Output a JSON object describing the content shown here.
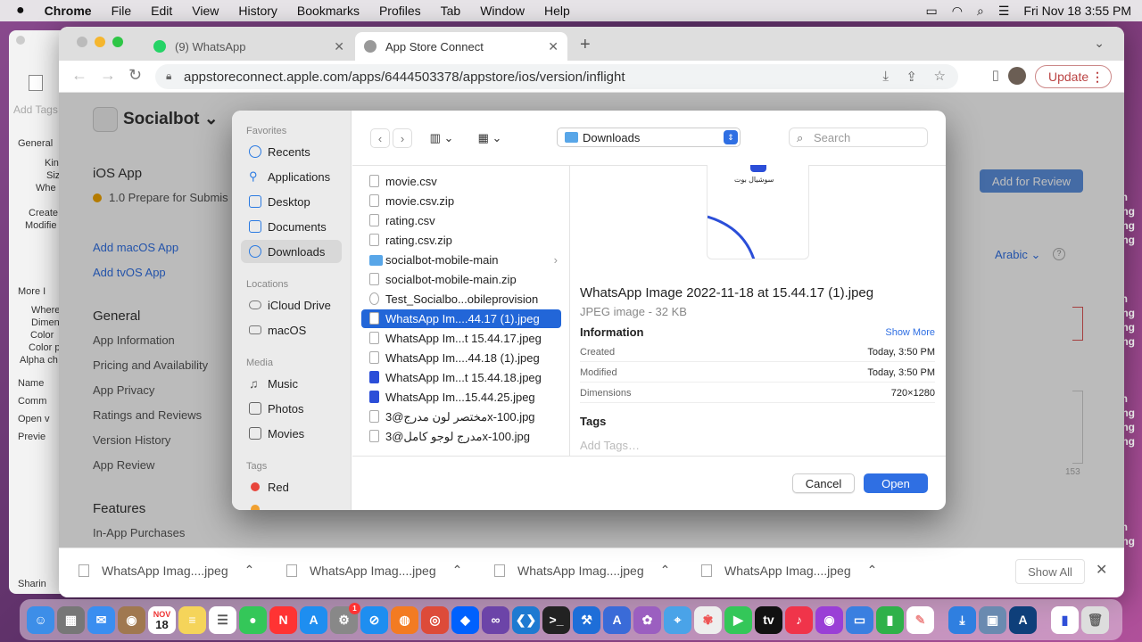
{
  "menubar": {
    "app": "Chrome",
    "items": [
      "File",
      "Edit",
      "View",
      "History",
      "Bookmarks",
      "Profiles",
      "Tab",
      "Window",
      "Help"
    ],
    "datetime": "Fri Nov 18  3:55 PM"
  },
  "behind_window": {
    "add_tags": "Add Tags",
    "labels": [
      "General",
      "Kin",
      "Siz",
      "Whe",
      "Create",
      "Modifie",
      "More I",
      "Where",
      "Dimen",
      "Color",
      "Color p",
      "Alpha ch",
      "Name",
      "Comm",
      "Open v",
      "Previe",
      "Sharin"
    ]
  },
  "right_strip": [
    "en",
    "ong",
    "ong",
    "ong",
    "en",
    "ong",
    "ong",
    "ong",
    "en",
    "ong",
    "ong",
    "ong",
    "en",
    "ong"
  ],
  "browser": {
    "tabs": [
      {
        "title": "(9) WhatsApp",
        "favicon_color": "#25d366"
      },
      {
        "title": "App Store Connect",
        "favicon_color": "#888888"
      }
    ],
    "url": "appstoreconnect.apple.com/apps/6444503378/appstore/ios/version/inflight",
    "update_label": "Update"
  },
  "page": {
    "app_name": "Socialbot",
    "ios_app": "iOS App",
    "version": "1.0 Prepare for Submis",
    "add_macos": "Add macOS App",
    "add_tvos": "Add tvOS App",
    "general_heading": "General",
    "general_items": [
      "App Information",
      "Pricing and Availability",
      "App Privacy",
      "Ratings and Reviews",
      "Version History",
      "App Review"
    ],
    "features_heading": "Features",
    "features_items": [
      "In-App Purchases"
    ],
    "add_for_review": "Add for Review",
    "language": "Arabic",
    "char_count": "153"
  },
  "downloads_bar": {
    "items": [
      "WhatsApp Imag....jpeg",
      "WhatsApp Imag....jpeg",
      "WhatsApp Imag....jpeg",
      "WhatsApp Imag....jpeg"
    ],
    "show_all": "Show All"
  },
  "dialog": {
    "sidebar": {
      "favorites_label": "Favorites",
      "favorites": [
        "Recents",
        "Applications",
        "Desktop",
        "Documents",
        "Downloads"
      ],
      "locations_label": "Locations",
      "locations": [
        "iCloud Drive",
        "macOS"
      ],
      "media_label": "Media",
      "media": [
        "Music",
        "Photos",
        "Movies"
      ],
      "tags_label": "Tags",
      "tags": [
        "Red"
      ]
    },
    "location": "Downloads",
    "search_placeholder": "Search",
    "files": [
      {
        "name": "movie.csv"
      },
      {
        "name": "movie.csv.zip"
      },
      {
        "name": "rating.csv"
      },
      {
        "name": "rating.csv.zip"
      },
      {
        "name": "socialbot-mobile-main",
        "chevron": "›"
      },
      {
        "name": "socialbot-mobile-main.zip"
      },
      {
        "name": "Test_Socialbo...obileprovision"
      },
      {
        "name": "WhatsApp Im....44.17 (1).jpeg"
      },
      {
        "name": "WhatsApp Im...t 15.44.17.jpeg"
      },
      {
        "name": "WhatsApp Im....44.18 (1).jpeg"
      },
      {
        "name": "WhatsApp Im...t 15.44.18.jpeg"
      },
      {
        "name": "WhatsApp Im...15.44.25.jpeg"
      },
      {
        "name": "مختصر لون مدرج@3x-100.jpg"
      },
      {
        "name": "مدرج لوجو كامل@3x-100.jpg"
      }
    ],
    "preview": {
      "thumb_text": "سوشيال بوت",
      "title": "WhatsApp Image 2022-11-18 at 15.44.17 (1).jpeg",
      "subtitle": "JPEG image - 32 KB",
      "info_heading": "Information",
      "show_more": "Show More",
      "rows": [
        {
          "key": "Created",
          "value": "Today, 3:50 PM"
        },
        {
          "key": "Modified",
          "value": "Today, 3:50 PM"
        },
        {
          "key": "Dimensions",
          "value": "720×1280"
        }
      ],
      "tags_heading": "Tags",
      "add_tags_placeholder": "Add Tags…"
    },
    "cancel_label": "Cancel",
    "open_label": "Open"
  },
  "dock": {
    "calendar_month": "NOV",
    "calendar_day": "18",
    "badge": "1"
  }
}
